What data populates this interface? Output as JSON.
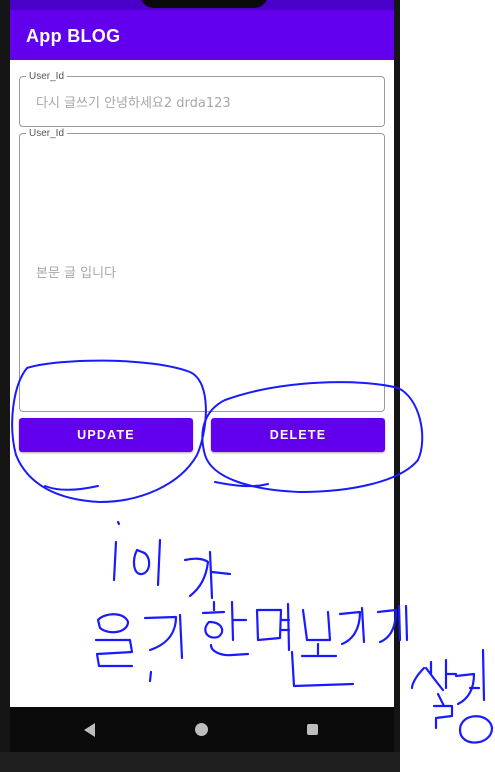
{
  "app_bar": {
    "title": "App BLOG"
  },
  "title_field": {
    "label": "User_Id",
    "placeholder": "다시 글쓰기 안녕하세요2 drda123"
  },
  "body_field": {
    "label": "User_Id",
    "placeholder": "본문 글 입니다"
  },
  "buttons": {
    "update_label": "UPDATE",
    "delete_label": "DELETE"
  },
  "handwritten_note": "id가 일치하면보이게 설정",
  "colors": {
    "primary": "#6200ee",
    "status_bar": "#4a00c8",
    "annotation_ink": "#1a1aff"
  },
  "icons": {
    "nav_back": "back-triangle-icon",
    "nav_home": "home-circle-icon",
    "nav_recent": "recent-apps-square-icon"
  }
}
